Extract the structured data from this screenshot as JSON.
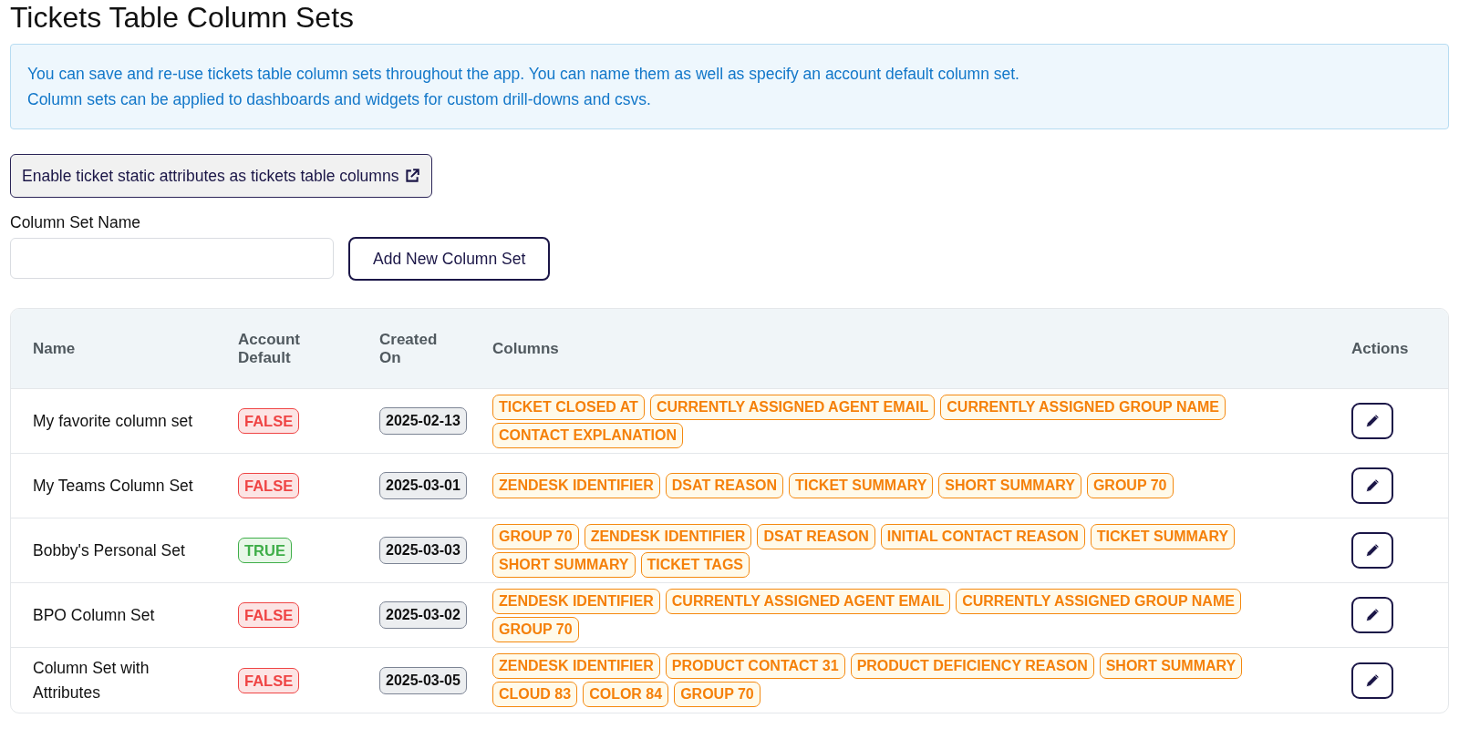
{
  "title": "Tickets Table Column Sets",
  "info": [
    "You can save and re-use tickets table column sets throughout the app. You can name them as well as specify an account default column set.",
    "Column sets can be applied to dashboards and widgets for custom drill-downs and csvs."
  ],
  "enable_button": "Enable ticket static attributes as tickets table columns",
  "name_field": {
    "label": "Column Set Name"
  },
  "add_button": "Add New Column Set",
  "table": {
    "columns": [
      "Name",
      "Account Default",
      "Created On",
      "Columns",
      "Actions"
    ],
    "rows": [
      {
        "name": "My favorite column set",
        "account_default": "FALSE",
        "is_default": false,
        "created_on": "2025-02-13",
        "columns": [
          "TICKET CLOSED AT",
          "CURRENTLY ASSIGNED AGENT EMAIL",
          "CURRENTLY ASSIGNED GROUP NAME",
          "CONTACT EXPLANATION"
        ]
      },
      {
        "name": "My Teams Column Set",
        "account_default": "FALSE",
        "is_default": false,
        "created_on": "2025-03-01",
        "columns": [
          "ZENDESK IDENTIFIER",
          "DSAT REASON",
          "TICKET SUMMARY",
          "SHORT SUMMARY",
          "GROUP 70"
        ]
      },
      {
        "name": "Bobby's Personal Set",
        "account_default": "TRUE",
        "is_default": true,
        "created_on": "2025-03-03",
        "columns": [
          "GROUP 70",
          "ZENDESK IDENTIFIER",
          "DSAT REASON",
          "INITIAL CONTACT REASON",
          "TICKET SUMMARY",
          "SHORT SUMMARY",
          "TICKET TAGS"
        ]
      },
      {
        "name": "BPO Column Set",
        "account_default": "FALSE",
        "is_default": false,
        "created_on": "2025-03-02",
        "columns": [
          "ZENDESK IDENTIFIER",
          "CURRENTLY ASSIGNED AGENT EMAIL",
          "CURRENTLY ASSIGNED GROUP NAME",
          "GROUP 70"
        ]
      },
      {
        "name": "Column Set with Attributes",
        "account_default": "FALSE",
        "is_default": false,
        "created_on": "2025-03-05",
        "columns": [
          "ZENDESK IDENTIFIER",
          "PRODUCT CONTACT 31",
          "PRODUCT DEFICIENCY REASON",
          "SHORT SUMMARY",
          "CLOUD 83",
          "COLOR 84",
          "GROUP 70"
        ]
      }
    ]
  }
}
